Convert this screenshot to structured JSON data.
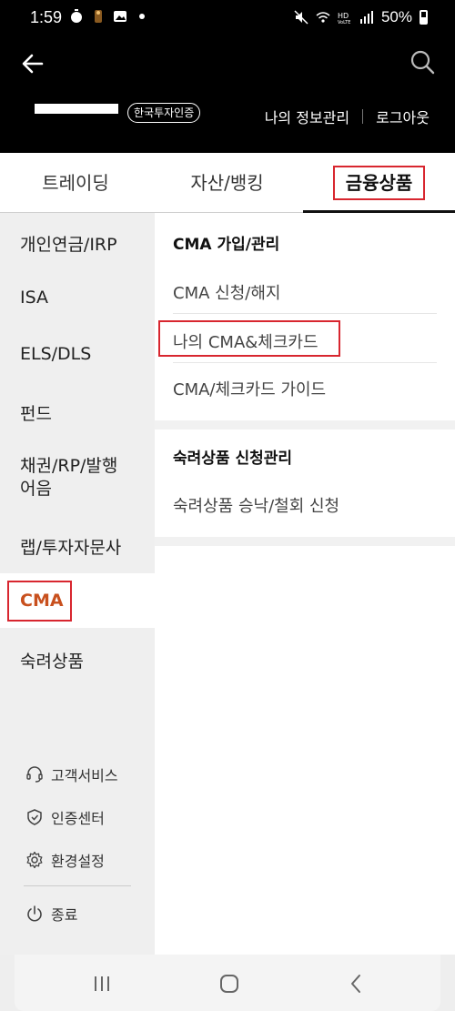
{
  "status_bar": {
    "time": "1:59",
    "battery": "50%",
    "icons": [
      "timer-icon",
      "figure-icon",
      "gallery-icon",
      "dot-icon",
      "mute-icon",
      "wifi-icon",
      "hd-voice-icon",
      "signal-icon",
      "battery-icon"
    ]
  },
  "header": {
    "cert_badge": "한국투자인증",
    "links": [
      "나의 정보관리",
      "로그아웃"
    ]
  },
  "tabs": [
    "트레이딩",
    "자산/뱅킹",
    "금융상품"
  ],
  "left_nav": {
    "items": [
      "개인연금/IRP",
      "ISA",
      "ELS/DLS",
      "펀드",
      "채권/RP/발행어음",
      "랩/투자자문사",
      "CMA",
      "숙려상품"
    ],
    "active": "CMA",
    "bond_line1": "채권/RP/발행",
    "bond_line2": "어음",
    "utilities": [
      "고객서비스",
      "인증센터",
      "환경설정",
      "종료"
    ]
  },
  "content": {
    "sections": [
      {
        "title": "CMA 가입/관리",
        "items": [
          "CMA 신청/해지",
          "나의 CMA&체크카드",
          "CMA/체크카드 가이드"
        ]
      },
      {
        "title": "숙려상품 신청관리",
        "items": [
          "숙려상품 승낙/철회 신청"
        ]
      }
    ]
  },
  "colors": {
    "highlight_box": "#d8262f",
    "active_nav": "#c8501e",
    "header_bg": "#000000",
    "left_nav_bg": "#efefef"
  }
}
